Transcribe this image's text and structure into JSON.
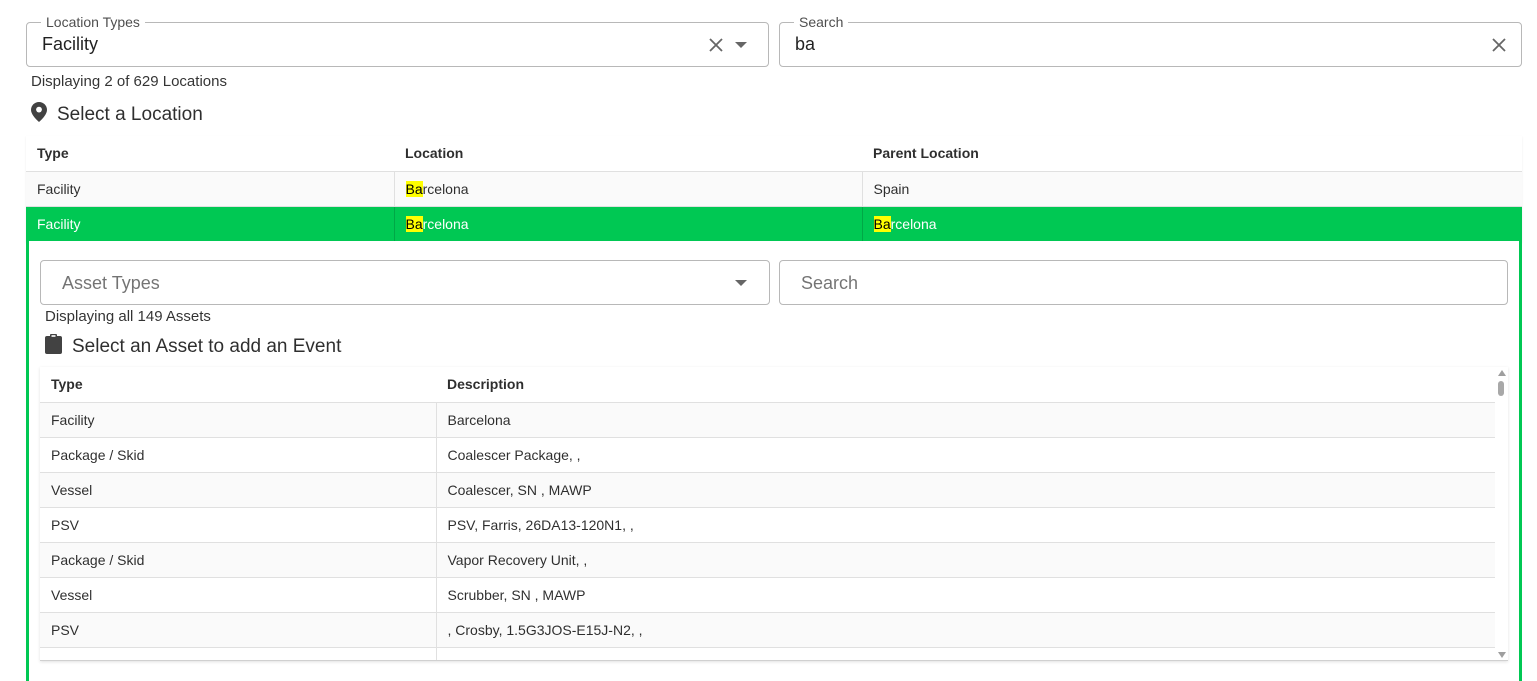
{
  "location_filter": {
    "legend": "Location Types",
    "value": "Facility",
    "clear_icon": "close-icon",
    "dropdown_icon": "caret-down-icon"
  },
  "location_search": {
    "legend": "Search",
    "value": "ba",
    "clear_icon": "close-icon"
  },
  "location_count_text": "Displaying 2 of 629 Locations",
  "location_section": {
    "icon": "map-pin-icon",
    "title": "Select a Location"
  },
  "locations_table": {
    "headers": [
      "Type",
      "Location",
      "Parent Location"
    ],
    "rows": [
      {
        "type": "Facility",
        "location_hl": "Ba",
        "location_rest": "rcelona",
        "parent_hl": "",
        "parent_rest": "Spain",
        "selected": false
      },
      {
        "type": "Facility",
        "location_hl": "Ba",
        "location_rest": "rcelona",
        "parent_hl": "Ba",
        "parent_rest": "rcelona",
        "selected": true
      }
    ]
  },
  "asset_filter": {
    "placeholder": "Asset Types",
    "dropdown_icon": "caret-down-icon"
  },
  "asset_search": {
    "placeholder": "Search"
  },
  "asset_count_text": "Displaying all 149 Assets",
  "asset_section": {
    "icon": "clipboard-icon",
    "title": "Select an Asset to add an Event"
  },
  "assets_table": {
    "headers": [
      "Type",
      "Description"
    ],
    "rows": [
      {
        "type": "Facility",
        "description": "Barcelona"
      },
      {
        "type": "Package / Skid",
        "description": "Coalescer Package, ,"
      },
      {
        "type": "Vessel",
        "description": "Coalescer, SN , MAWP"
      },
      {
        "type": "PSV",
        "description": "PSV, Farris, 26DA13-120N1, ,"
      },
      {
        "type": "Package / Skid",
        "description": "Vapor Recovery Unit, ,"
      },
      {
        "type": "Vessel",
        "description": "Scrubber, SN , MAWP"
      },
      {
        "type": "PSV",
        "description": ", Crosby, 1.5G3JOS-E15J-N2, ,"
      },
      {
        "type": "",
        "description": ""
      }
    ]
  },
  "colors": {
    "selected_row": "#00c853",
    "highlight": "#ffff00",
    "panel_border": "#00c853"
  }
}
